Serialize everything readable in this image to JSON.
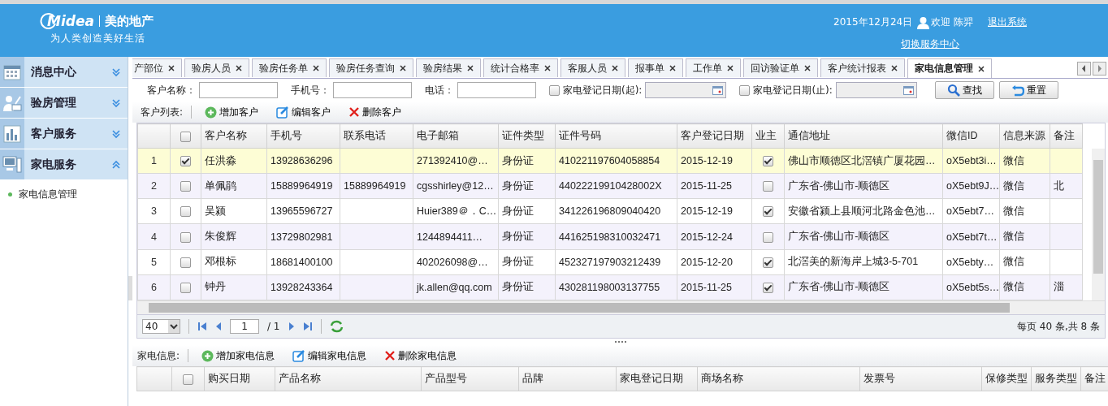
{
  "header": {
    "logo": "Midea",
    "brand": "美的地产",
    "slogan": "为人类创造美好生活",
    "date": "2015年12月24日",
    "user": "欢迎 陈羿",
    "logout": "退出系统",
    "switch_center": "切换服务中心"
  },
  "sidebar": {
    "items": [
      {
        "label": "消息中心",
        "expanded": false
      },
      {
        "label": "验房管理",
        "expanded": false
      },
      {
        "label": "客户服务",
        "expanded": false
      },
      {
        "label": "家电服务",
        "expanded": true,
        "children": [
          {
            "label": "家电信息管理"
          }
        ]
      }
    ]
  },
  "tabs": [
    {
      "label": "产部位",
      "selected": false
    },
    {
      "label": "验房人员",
      "selected": false
    },
    {
      "label": "验房任务单",
      "selected": false
    },
    {
      "label": "验房任务查询",
      "selected": false
    },
    {
      "label": "验房结果",
      "selected": false
    },
    {
      "label": "统计合格率",
      "selected": false
    },
    {
      "label": "客服人员",
      "selected": false
    },
    {
      "label": "报事单",
      "selected": false
    },
    {
      "label": "工作单",
      "selected": false
    },
    {
      "label": "回访验证单",
      "selected": false
    },
    {
      "label": "客户统计报表",
      "selected": false
    },
    {
      "label": "家电信息管理",
      "selected": true
    }
  ],
  "search": {
    "fields": [
      {
        "label": "客户名称：",
        "kind": "text"
      },
      {
        "label": "手机号：",
        "kind": "text"
      },
      {
        "label": "电话：",
        "kind": "text"
      },
      {
        "label": "家电登记日期(起):",
        "kind": "date",
        "checked": false
      },
      {
        "label": "家电登记日期(止):",
        "kind": "date",
        "checked": false
      }
    ],
    "buttons": [
      {
        "label": "查找",
        "kind": "search"
      },
      {
        "label": "重置",
        "kind": "reset"
      }
    ]
  },
  "customer_toolbar": {
    "title": "客户列表:",
    "actions": [
      {
        "label": "增加客户",
        "kind": "add"
      },
      {
        "label": "编辑客户",
        "kind": "edit"
      },
      {
        "label": "删除客户",
        "kind": "delete"
      }
    ]
  },
  "customer_table": {
    "header_checked": false,
    "columns": [
      "客户名称",
      "手机号",
      "联系电话",
      "电子邮箱",
      "证件类型",
      "证件号码",
      "客户登记日期",
      "业主",
      "通信地址",
      "微信ID",
      "信息来源",
      "备注"
    ],
    "rows": [
      {
        "number": "1",
        "selected": true,
        "checked": true,
        "name": "任洪淼",
        "mobile": "13928636296",
        "email": "271392410@…",
        "id_type": "身份证",
        "id_number": "410221197604058854",
        "reg_date": "2015-12-19",
        "owner": true,
        "address": "佛山市顺德区北滘镇广厦花园…",
        "wechat_id": "oX5ebt3i…",
        "source": "微信"
      },
      {
        "number": "2",
        "selected": false,
        "checked": false,
        "name": "单佩鹃",
        "mobile": "15889964919",
        "phone": "15889964919",
        "email": "cgsshirley@12…",
        "id_type": "身份证",
        "id_number": "44022219910428002X",
        "reg_date": "2015-11-25",
        "owner": false,
        "address": "广东省-佛山市-顺德区",
        "wechat_id": "oX5ebt9J…",
        "source": "微信",
        "remark": "北"
      },
      {
        "number": "3",
        "selected": false,
        "checked": false,
        "name": "吴颍",
        "mobile": "13965596727",
        "email": "Huier389＠．C…",
        "id_type": "身份证",
        "id_number": "341226196809040420",
        "reg_date": "2015-12-19",
        "owner": true,
        "address": "安徽省颍上县顺河北路金色池…",
        "wechat_id": "oX5ebt7…",
        "source": "微信"
      },
      {
        "number": "4",
        "selected": false,
        "checked": false,
        "name": "朱俊辉",
        "mobile": "13729802981",
        "email": "1244894411…",
        "id_type": "身份证",
        "id_number": "441625198310032471",
        "reg_date": "2015-12-24",
        "owner": false,
        "address": "广东省-佛山市-顺德区",
        "wechat_id": "oX5ebt7t…",
        "source": "微信"
      },
      {
        "number": "5",
        "selected": false,
        "checked": false,
        "name": "邓根标",
        "mobile": "18681400100",
        "email": "402026098@…",
        "id_type": "身份证",
        "id_number": "452327197903212439",
        "reg_date": "2015-12-20",
        "owner": true,
        "address": "北滘美的新海岸上城3-5-701",
        "wechat_id": "oX5ebty…",
        "source": "微信"
      },
      {
        "number": "6",
        "selected": false,
        "checked": false,
        "name": "钟丹",
        "mobile": "13928243364",
        "email": "jk.allen@qq.com",
        "id_type": "身份证",
        "id_number": "430281198003137755",
        "reg_date": "2015-11-25",
        "owner": true,
        "address": "广东省-佛山市-顺德区",
        "wechat_id": "oX5ebt5s…",
        "source": "微信",
        "remark": "淄"
      }
    ]
  },
  "pager": {
    "page_size": "40",
    "page": "1",
    "total_pages": "/ 1",
    "summary": "每页 40 条,共 8 条"
  },
  "appliance_toolbar": {
    "title": "家电信息:",
    "actions": [
      {
        "label": "增加家电信息",
        "kind": "add"
      },
      {
        "label": "编辑家电信息",
        "kind": "edit"
      },
      {
        "label": "删除家电信息",
        "kind": "delete"
      }
    ]
  },
  "appliance_table": {
    "header_checked": false,
    "columns": [
      "购买日期",
      "产品名称",
      "产品型号",
      "品牌",
      "家电登记日期",
      "商场名称",
      "发票号",
      "保修类型",
      "服务类型",
      "备注"
    ]
  }
}
